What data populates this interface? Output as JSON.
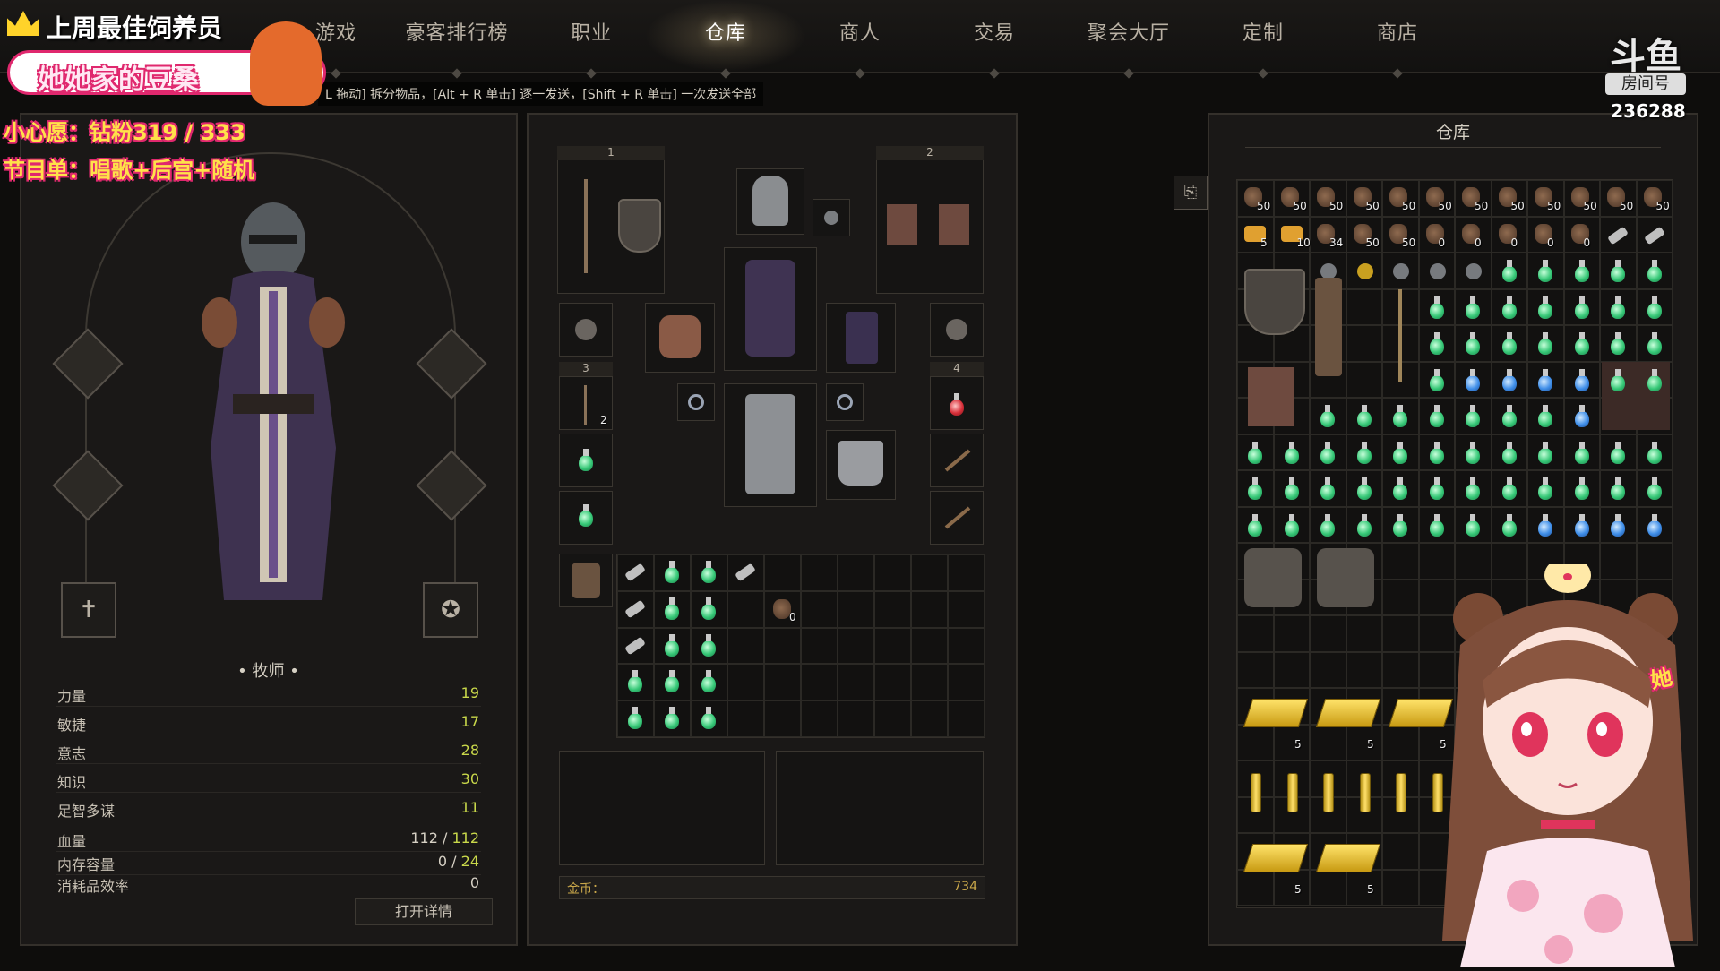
{
  "nav": {
    "items": [
      {
        "label": "游戏"
      },
      {
        "label": "豪客排行榜"
      },
      {
        "label": "职业"
      },
      {
        "label": "仓库"
      },
      {
        "label": "商人"
      },
      {
        "label": "交易"
      },
      {
        "label": "聚会大厅"
      },
      {
        "label": "定制"
      },
      {
        "label": "商店"
      }
    ],
    "active": "仓库"
  },
  "hint": "L 拖动] 拆分物品，[Alt + R 单击] 逐一发送，[Shift + R 单击] 一次发送全部",
  "character": {
    "class_name": "• 牧师 •",
    "stats": [
      {
        "label": "力量",
        "value": "19"
      },
      {
        "label": "敏捷",
        "value": "17"
      },
      {
        "label": "意志",
        "value": "28"
      },
      {
        "label": "知识",
        "value": "30"
      },
      {
        "label": "足智多谋",
        "value": "11"
      }
    ],
    "hp_label": "血量",
    "hp_current": "112",
    "hp_sep": "/",
    "hp_max": "112",
    "memory_label": "内存容量",
    "memory_current": "0",
    "memory_sep": "/",
    "memory_max": "24",
    "consumable_label": "消耗品效率",
    "consumable_value": "0",
    "details_button": "打开详情"
  },
  "equipment": {
    "slot_numbers": [
      "1",
      "2",
      "3",
      "4"
    ],
    "weapon_count": "2",
    "gold_label": "金币：",
    "gold_value": "734",
    "bag_count": "0"
  },
  "stash": {
    "title": "仓库",
    "row1_qty": [
      "50",
      "50",
      "50",
      "50",
      "50",
      "50",
      "50",
      "50",
      "50",
      "50",
      "50",
      "50"
    ],
    "row2_qty": [
      "5",
      "10",
      "34",
      "50",
      "50",
      "0",
      "0",
      "0",
      "0",
      "0"
    ],
    "gold_qty": [
      "5",
      "5",
      "5",
      "5",
      "5"
    ]
  },
  "stream_overlay": {
    "line1": "上周最佳饲养员",
    "name": "她她家的豆桑",
    "line2": "小心愿：钻粉319 / 333",
    "line3": "节目单：唱歌+后宫+随机",
    "room_label": "房间号",
    "room_id": "236288",
    "logo_text": "斗鱼",
    "vtuber_tag": "她"
  },
  "colors": {
    "accent_stat": "#c9d84a",
    "overlay_yellow": "#ffe14a",
    "overlay_pink": "#e0286e"
  }
}
